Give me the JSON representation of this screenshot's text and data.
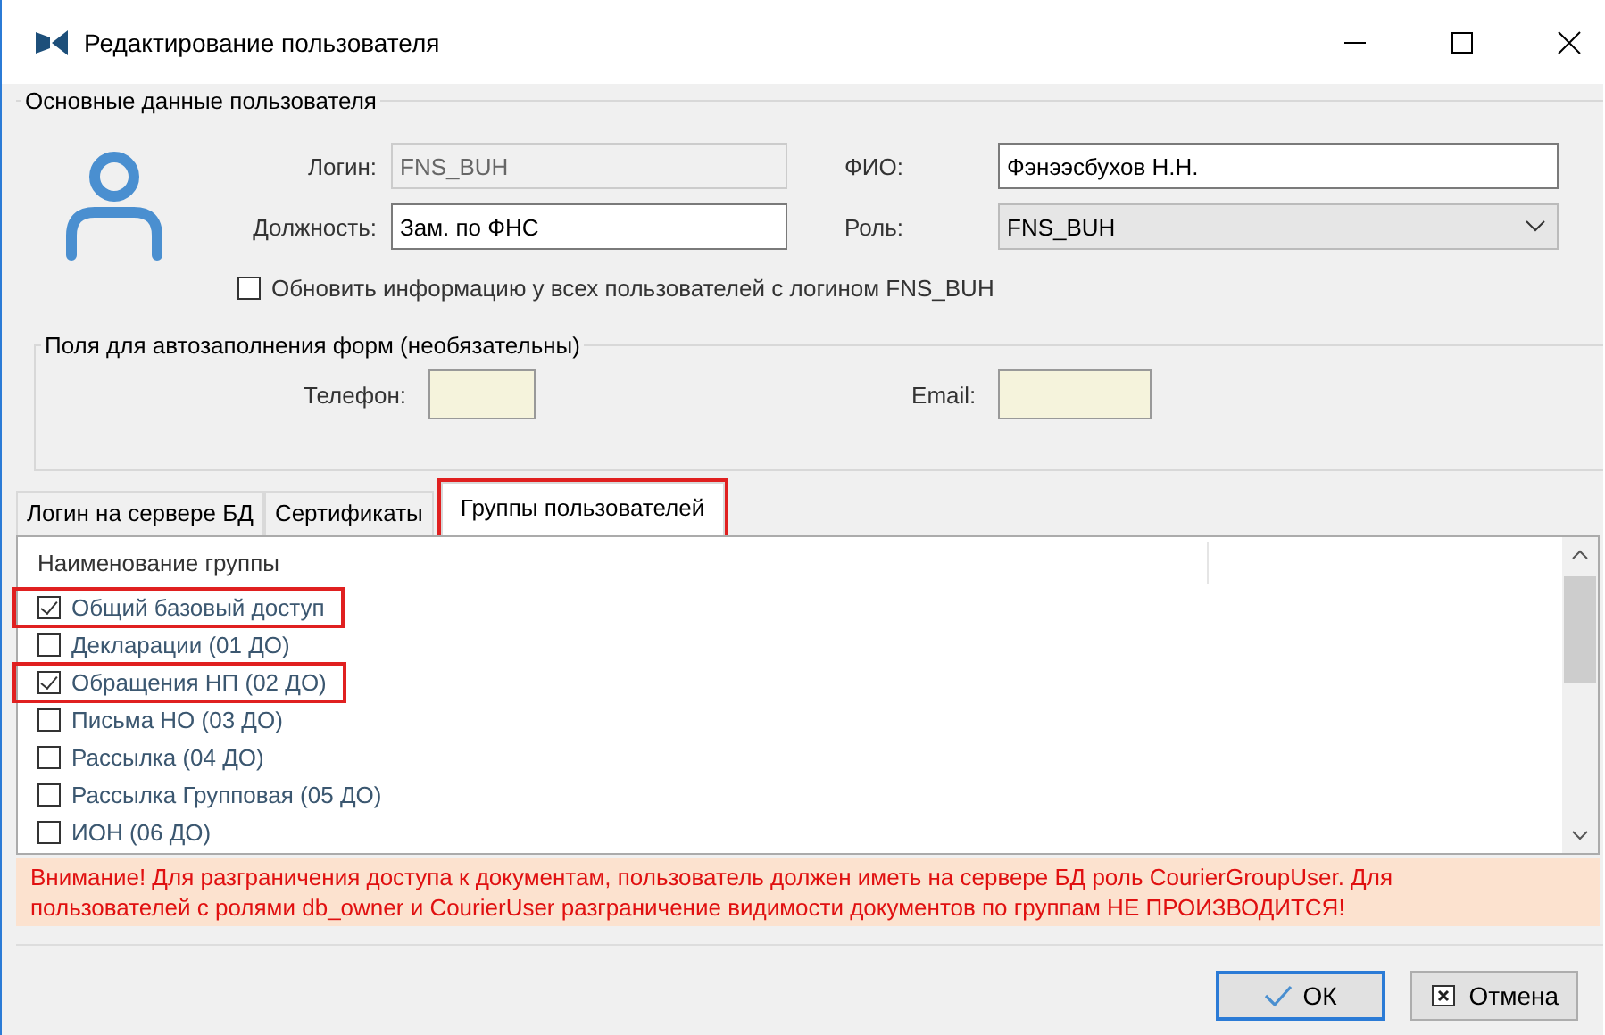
{
  "window": {
    "title": "Редактирование пользователя"
  },
  "main_group": {
    "title": "Основные данные пользователя",
    "fields": [
      {
        "label": "Логин:",
        "value": "FNS_BUH",
        "disabled": true,
        "kind": "text"
      },
      {
        "label": "ФИО:",
        "value": "Фэнээсбухов Н.Н.",
        "disabled": false,
        "kind": "text"
      },
      {
        "label": "Должность:",
        "value": "Зам. по ФНС",
        "disabled": false,
        "kind": "text"
      },
      {
        "label": "Роль:",
        "value": "FNS_BUH",
        "disabled": false,
        "kind": "combo"
      }
    ],
    "update_all": {
      "label": "Обновить информацию у всех пользователей с логином FNS_BUH",
      "checked": false
    }
  },
  "autofill_group": {
    "title": "Поля для автозаполнения форм (необязательны)",
    "fields": [
      {
        "label": "Телефон:"
      },
      {
        "label": "Email:"
      }
    ]
  },
  "tabs": [
    {
      "label": "Логин на сервере БД",
      "selected": false,
      "highlighted": false
    },
    {
      "label": "Сертификаты",
      "selected": false,
      "highlighted": false
    },
    {
      "label": "Группы пользователей",
      "selected": true,
      "highlighted": true
    }
  ],
  "groups_list": {
    "column": "Наименование группы",
    "rows": [
      {
        "name": "Общий базовый доступ",
        "checked": true,
        "highlighted": true
      },
      {
        "name": "Декларации (01 ДО)",
        "checked": false,
        "highlighted": false
      },
      {
        "name": "Обращения НП (02 ДО)",
        "checked": true,
        "highlighted": true
      },
      {
        "name": "Письма НО (03 ДО)",
        "checked": false,
        "highlighted": false
      },
      {
        "name": "Рассылка (04 ДО)",
        "checked": false,
        "highlighted": false
      },
      {
        "name": "Рассылка Групповая (05 ДО)",
        "checked": false,
        "highlighted": false
      },
      {
        "name": "ИОН (06 ДО)",
        "checked": false,
        "highlighted": false
      }
    ]
  },
  "warning": "Внимание! Для разграничения доступа к документам, пользователь должен иметь на сервере БД роль CourierGroupUser. Для пользователей с ролями db_owner и CourierUser разграничение видимости документов по группам НЕ ПРОИЗВОДИТСЯ!",
  "buttons": [
    {
      "label": "ОК",
      "kind": "ok"
    },
    {
      "label": "Отмена",
      "kind": "cancel"
    }
  ]
}
